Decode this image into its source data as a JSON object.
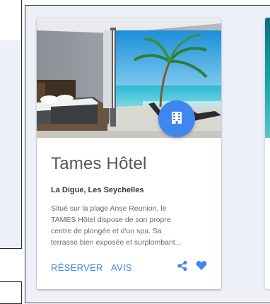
{
  "card": {
    "title": "Tames Hôtel",
    "location": "La Digue, Les Seychelles",
    "description_lines": [
      "Situé sur la plage Anse Reunion, le",
      "TAMES Hôtel dispose de son propre",
      "centre de plongée et d'un spa. Sa",
      "terrasse bien exposée et surplombant..."
    ],
    "actions": {
      "reserve_label": "RÉSERVER",
      "reviews_label": "AVIS"
    },
    "icons": {
      "fab": "hotel-building-icon",
      "share": "share-icon",
      "favorite": "heart-icon"
    }
  },
  "colors": {
    "accent": "#3f86ee",
    "background": "#eef0f8",
    "title_text": "#555555",
    "body_text": "#6a6a6a"
  }
}
